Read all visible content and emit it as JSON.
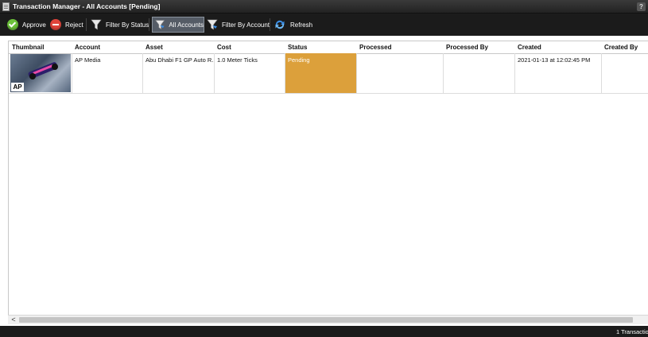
{
  "window": {
    "title": "Transaction Manager - All Accounts [Pending]",
    "help_label": "?"
  },
  "toolbar": {
    "approve_label": "Approve",
    "reject_label": "Reject",
    "filter_status_label": "Filter By Status",
    "all_accounts_label": "All Accounts",
    "filter_account_label": "Filter By Account",
    "refresh_label": "Refresh"
  },
  "table": {
    "columns": [
      "Thumbnail",
      "Account",
      "Asset",
      "Cost",
      "Status",
      "Processed",
      "Processed By",
      "Created",
      "Created By"
    ],
    "rows": [
      {
        "thumbnail_badge": "AP",
        "account": "AP Media",
        "asset": "Abu Dhabi F1 GP Auto R...",
        "cost": "1.0 Meter Ticks",
        "status": "Pending",
        "processed": "",
        "processed_by": "",
        "created": "2021-01-13 at 12:02:45 PM",
        "created_by": ""
      }
    ]
  },
  "scrollbar": {
    "left_arrow": "<"
  },
  "statusbar": {
    "count_text": "1 Transactio"
  },
  "colors": {
    "pending": "#dca03b",
    "toolbar_bg": "#1b1b1b",
    "approve": "#6cc13a",
    "reject": "#e0443a"
  }
}
